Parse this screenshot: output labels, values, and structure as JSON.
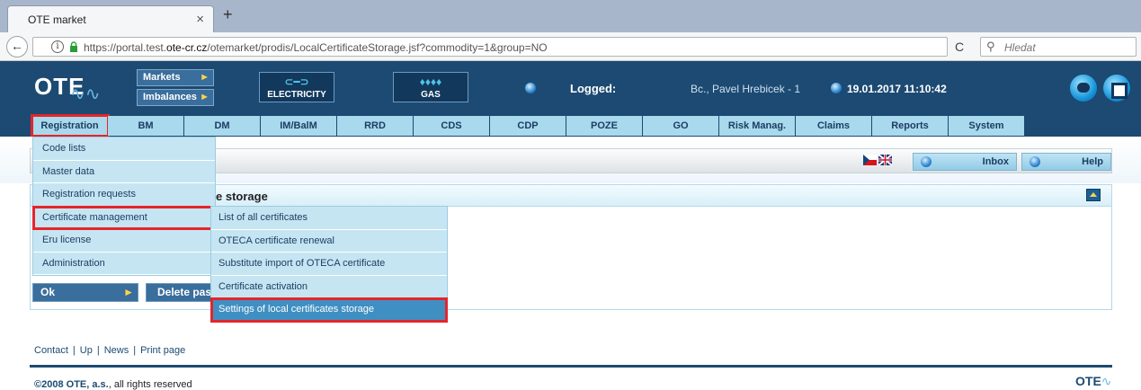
{
  "browser": {
    "tab_title": "OTE market",
    "tab_close": "×",
    "new_tab": "+",
    "url_prefix": "https://portal.test.",
    "url_domain": "ote-cr.cz",
    "url_path": "/otemarket/prodis/LocalCertificateStorage.jsf?commodity=1&group=NO",
    "search_placeholder": "Hledat",
    "back_glyph": "←",
    "reload_glyph": "C",
    "search_glyph": "⚲"
  },
  "header": {
    "logo_text": "OTE",
    "logo_wave": "∿∿",
    "markets_label": "Markets",
    "imbalances_label": "Imbalances",
    "electricity_label": "ELECTRICITY",
    "gas_label": "GAS",
    "logged_label": "Logged:",
    "user_name": "Bc., Pavel Hrebicek - 1",
    "datetime": "19.01.2017 11:10:42",
    "arrow_glyph": "►"
  },
  "main_menu": [
    {
      "label": "Registration"
    },
    {
      "label": "BM"
    },
    {
      "label": "DM"
    },
    {
      "label": "IM/BalM"
    },
    {
      "label": "RRD"
    },
    {
      "label": "CDS"
    },
    {
      "label": "CDP"
    },
    {
      "label": "POZE"
    },
    {
      "label": "GO"
    },
    {
      "label": "Risk Manag."
    },
    {
      "label": "Claims"
    },
    {
      "label": "Reports"
    },
    {
      "label": "System"
    }
  ],
  "toolbar": {
    "inbox_label": "Inbox",
    "help_label": "Help"
  },
  "registration_dropdown": [
    {
      "label": "Code lists"
    },
    {
      "label": "Master data"
    },
    {
      "label": "Registration requests"
    },
    {
      "label": "Certificate management"
    },
    {
      "label": "Eru license"
    },
    {
      "label": "Administration"
    }
  ],
  "certificate_submenu": [
    {
      "label": "List of all certificates"
    },
    {
      "label": "OTECA certificate renewal"
    },
    {
      "label": "Substitute import of OTECA certificate"
    },
    {
      "label": "Certificate activation"
    },
    {
      "label": "Settings of local certificates storage"
    }
  ],
  "panel": {
    "title": "e storage",
    "ok_label": "Ok",
    "delete_label": "Delete pas"
  },
  "footer": {
    "links": [
      "Contact",
      "Up",
      "News",
      "Print page"
    ],
    "separator": "|",
    "copyright_brand": "©2008 OTE, a.s.",
    "copyright_rest": ", all rights reserved",
    "logo_text": "OTE"
  },
  "colors": {
    "header_blue": "#1c4a72",
    "menu_light_blue": "#a8d9ec",
    "highlight_red": "#e5252a",
    "selected_item_blue": "#3f8fc2"
  }
}
